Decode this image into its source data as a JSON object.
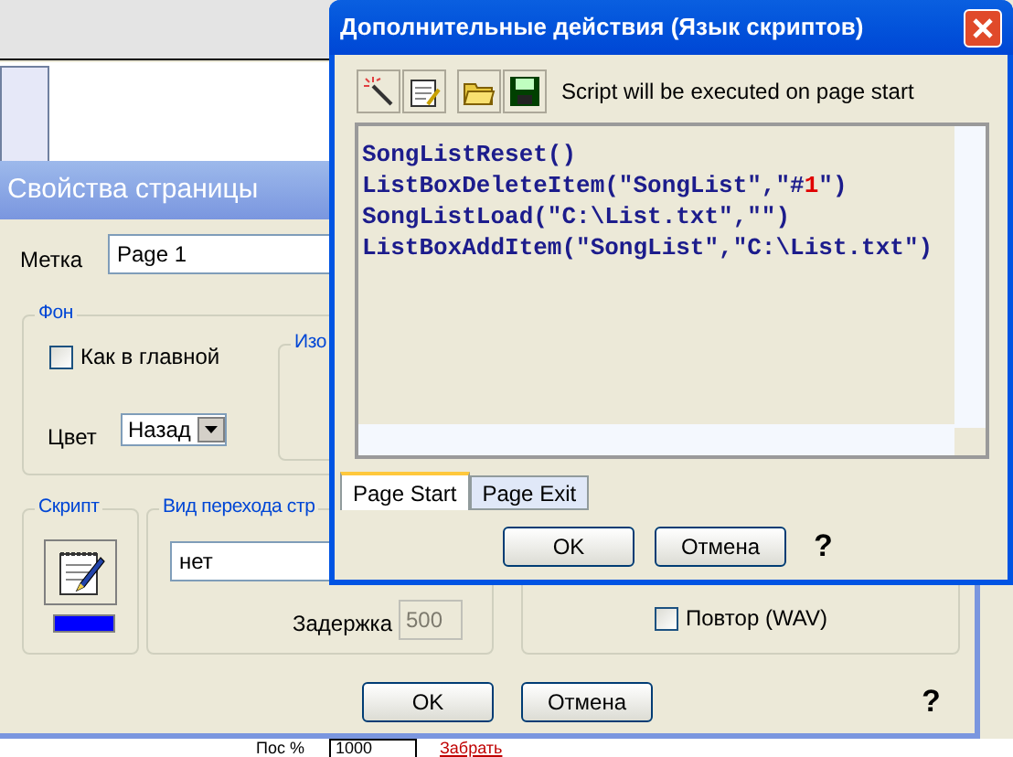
{
  "background_app": {
    "bottom_strip": {
      "label": "Пос %",
      "value": "1000",
      "link": "Забрать"
    }
  },
  "page_properties_dialog": {
    "title": "Свойства страницы",
    "label_field": {
      "label": "Метка",
      "value": "Page 1"
    },
    "background_group": {
      "title": "Фон",
      "same_as_main": {
        "label": "Как в главной",
        "checked": false
      },
      "color": {
        "label": "Цвет",
        "value": "Назад"
      }
    },
    "image_group": {
      "title": "Изо"
    },
    "script_group": {
      "title": "Скрипт"
    },
    "transition_group": {
      "title": "Вид перехода стр",
      "value": "нет",
      "delay": {
        "label": "Задержка",
        "value": "500",
        "disabled": true
      }
    },
    "sound_group": {
      "repeat": {
        "label": "Повтор (WAV)",
        "checked": false
      }
    },
    "buttons": [
      "OK",
      "Отмена"
    ],
    "help": "?"
  },
  "script_dialog": {
    "title": "Дополнительные действия (Язык скриптов)",
    "toolbar_note": "Script will be executed on page start",
    "code_lines": [
      "SongListReset()",
      "ListBoxDeleteItem(\"SongList\",\"#1\")",
      "SongListLoad(\"C:\\List.txt\",\"\")",
      "ListBoxAddItem(\"SongList\",\"C:\\List.txt\")"
    ],
    "tabs": [
      {
        "label": "Page Start",
        "selected": true
      },
      {
        "label": "Page Exit",
        "selected": false
      }
    ],
    "buttons": [
      "OK",
      "Отмена"
    ],
    "help": "?"
  }
}
